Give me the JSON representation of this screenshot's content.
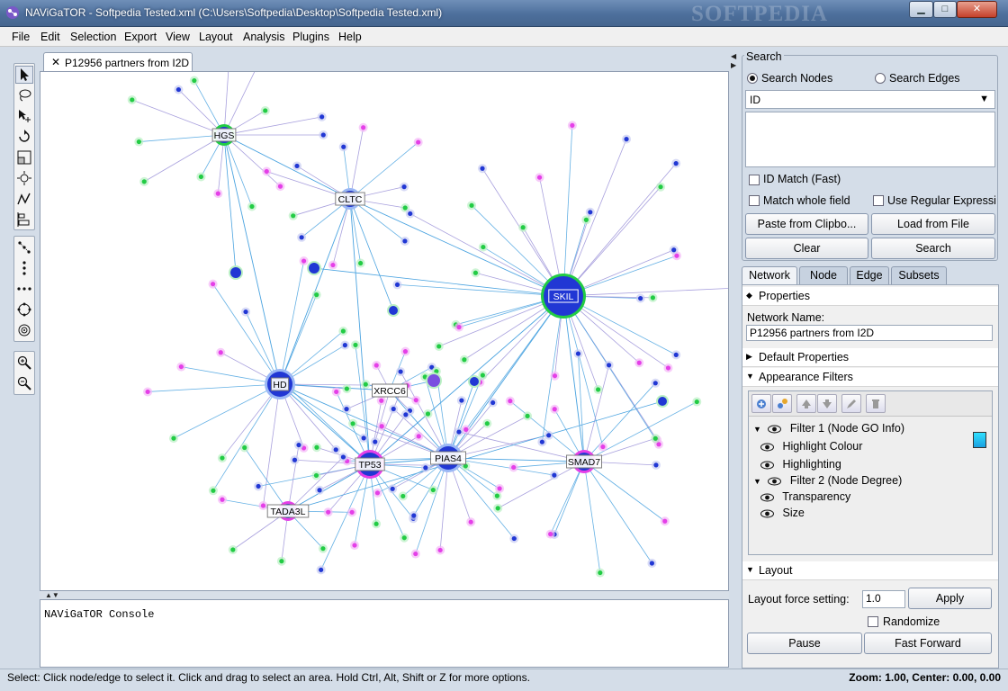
{
  "window": {
    "title": "NAViGaTOR - Softpedia Tested.xml (C:\\Users\\Softpedia\\Desktop\\Softpedia Tested.xml)",
    "watermark": "SOFTPEDIA",
    "min_glyph": "▁",
    "max_glyph": "□",
    "close_glyph": "✕"
  },
  "menu": [
    "File",
    "Edit",
    "Selection",
    "Export",
    "View",
    "Layout",
    "Analysis",
    "Plugins",
    "Help"
  ],
  "toolbar": {
    "tools": [
      "select-pointer-icon",
      "lasso-icon",
      "move-node-icon",
      "rotate-icon",
      "scale-icon",
      "zoom-region-icon",
      "path-icon",
      "align-icon",
      "layout-linear-icon",
      "layout-vertical-icon",
      "layout-horizontal-icon",
      "layout-circle-icon",
      "layout-radial-icon",
      "zoom-in-icon",
      "zoom-out-icon"
    ]
  },
  "graph_tab": {
    "close": "✕",
    "label": "P12956 partners from I2D"
  },
  "graph": {
    "labeled_nodes": [
      {
        "label": "HGS",
        "kind": "hub-green"
      },
      {
        "label": "CLTC",
        "kind": "hub-blue"
      },
      {
        "label": "SKIL",
        "kind": "big-hub"
      },
      {
        "label": "HD",
        "kind": "hub-blue"
      },
      {
        "label": "XRCC6",
        "kind": "plain"
      },
      {
        "label": "TP53",
        "kind": "hub-pink"
      },
      {
        "label": "PIAS4",
        "kind": "hub-blue"
      },
      {
        "label": "SMAD7",
        "kind": "hub-pink"
      },
      {
        "label": "TADA3L",
        "kind": "hub-pink-small"
      }
    ],
    "colors": {
      "edge_blue": "#4aa3e0",
      "edge_purple": "#9a90d8",
      "node_blue": "#2137d4",
      "node_green": "#22cc44",
      "node_pink": "#e53fe8"
    }
  },
  "console": {
    "text": "NAViGaTOR Console"
  },
  "search": {
    "title": "Search",
    "nodes_label": "Search Nodes",
    "edges_label": "Search Edges",
    "field": "ID",
    "id_match": "ID Match (Fast)",
    "whole_field": "Match whole field",
    "regex": "Use Regular Expressi...",
    "paste": "Paste from Clipbo...",
    "load": "Load from File",
    "clear": "Clear",
    "search": "Search"
  },
  "tabs": [
    "Network",
    "Node",
    "Edge",
    "Subsets"
  ],
  "properties": {
    "header": "Properties",
    "network_name_label": "Network Name:",
    "network_name_value": "P12956 partners from I2D",
    "default_props": "Default Properties",
    "appearance_filters": "Appearance Filters",
    "filter_tree": [
      {
        "label": "Filter 1 (Node GO Info)",
        "level": 0
      },
      {
        "label": "Highlight Colour",
        "level": 1
      },
      {
        "label": "Highlighting",
        "level": 1
      },
      {
        "label": "Filter 2 (Node Degree)",
        "level": 0
      },
      {
        "label": "Transparency",
        "level": 1
      },
      {
        "label": "Size",
        "level": 1
      }
    ],
    "layout_header": "Layout",
    "layout_force_label": "Layout force setting:",
    "layout_force_value": "1.0",
    "apply": "Apply",
    "randomize": "Randomize",
    "pause": "Pause",
    "fast_forward": "Fast Forward"
  },
  "status": {
    "left": "Select: Click node/edge to select it. Click and drag to select an area. Hold Ctrl, Alt, Shift or Z for more options.",
    "right": "Zoom: 1.00, Center: 0.00, 0.00"
  }
}
